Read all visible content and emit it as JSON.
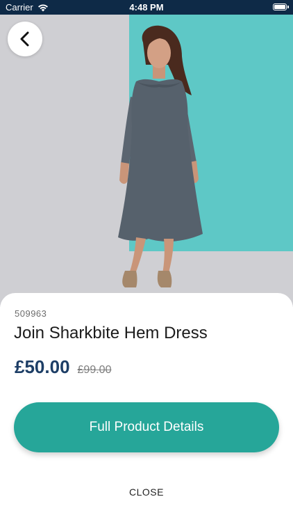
{
  "status_bar": {
    "carrier": "Carrier",
    "time": "4:48 PM",
    "wifi_icon": "wifi-icon",
    "battery_icon": "battery-icon"
  },
  "hero": {
    "image_description": "product-photo",
    "back_icon": "chevron-left-icon"
  },
  "product": {
    "sku": "509963",
    "name": "Join Sharkbite Hem Dress",
    "price": "£50.00",
    "original_price": "£99.00"
  },
  "actions": {
    "details_label": "Full Product Details",
    "close_label": "CLOSE"
  },
  "colors": {
    "status_bar": "#0e2a47",
    "photo_background": "#cfcfd3",
    "photo_teal": "#5ec8c6",
    "primary_button": "#26a699",
    "price": "#1d3e66"
  }
}
